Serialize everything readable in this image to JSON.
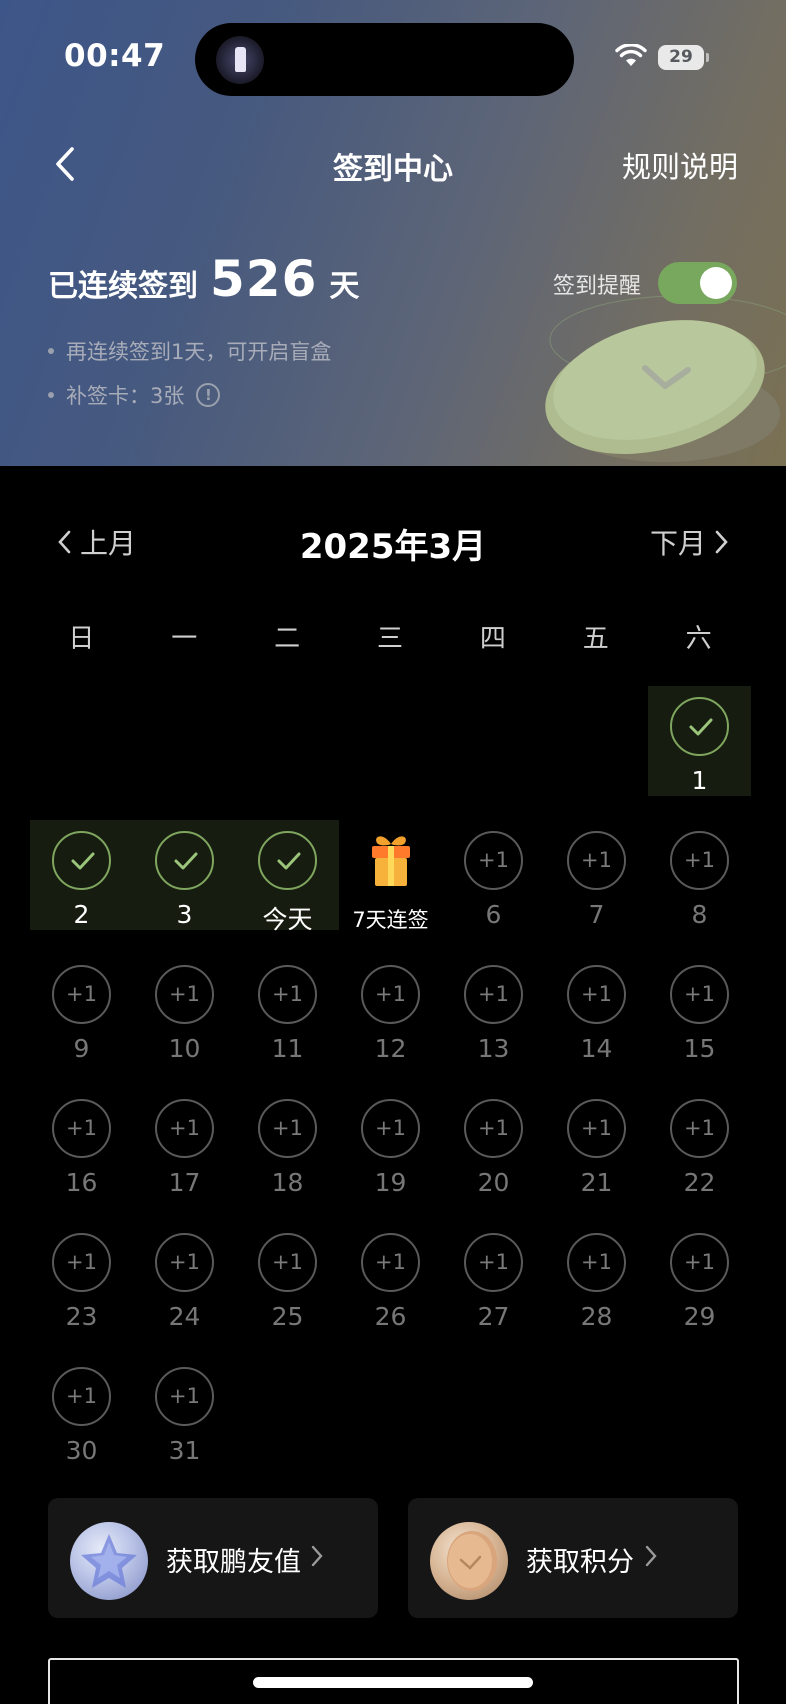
{
  "status_bar": {
    "time": "00:47",
    "battery": "29"
  },
  "nav": {
    "title": "签到中心",
    "rules": "规则说明"
  },
  "streak": {
    "prefix": "已连续签到",
    "days": "526",
    "suffix": "天"
  },
  "tips": [
    "再连续签到1天，可开启盲盒",
    "补签卡：3张"
  ],
  "reminder": {
    "label": "签到提醒",
    "enabled": true
  },
  "calendar": {
    "title": "2025年3月",
    "prev": "上月",
    "next": "下月",
    "weekdays": [
      "日",
      "一",
      "二",
      "三",
      "四",
      "五",
      "六"
    ],
    "leading_blanks": 6,
    "reward_text": "+1",
    "days": [
      {
        "label": "1",
        "status": "checked"
      },
      {
        "label": "2",
        "status": "checked"
      },
      {
        "label": "3",
        "status": "checked"
      },
      {
        "label": "今天",
        "status": "checked"
      },
      {
        "label": "7天连签",
        "status": "gift"
      },
      {
        "label": "6",
        "status": "pending"
      },
      {
        "label": "7",
        "status": "pending"
      },
      {
        "label": "8",
        "status": "pending"
      },
      {
        "label": "9",
        "status": "pending"
      },
      {
        "label": "10",
        "status": "pending"
      },
      {
        "label": "11",
        "status": "pending"
      },
      {
        "label": "12",
        "status": "pending"
      },
      {
        "label": "13",
        "status": "pending"
      },
      {
        "label": "14",
        "status": "pending"
      },
      {
        "label": "15",
        "status": "pending"
      },
      {
        "label": "16",
        "status": "pending"
      },
      {
        "label": "17",
        "status": "pending"
      },
      {
        "label": "18",
        "status": "pending"
      },
      {
        "label": "19",
        "status": "pending"
      },
      {
        "label": "20",
        "status": "pending"
      },
      {
        "label": "21",
        "status": "pending"
      },
      {
        "label": "22",
        "status": "pending"
      },
      {
        "label": "23",
        "status": "pending"
      },
      {
        "label": "24",
        "status": "pending"
      },
      {
        "label": "25",
        "status": "pending"
      },
      {
        "label": "26",
        "status": "pending"
      },
      {
        "label": "27",
        "status": "pending"
      },
      {
        "label": "28",
        "status": "pending"
      },
      {
        "label": "29",
        "status": "pending"
      },
      {
        "label": "30",
        "status": "pending"
      },
      {
        "label": "31",
        "status": "pending"
      }
    ]
  },
  "cards": [
    {
      "label": "获取鹏友值",
      "icon": "crystal-star-icon"
    },
    {
      "label": "获取积分",
      "icon": "points-coin-icon"
    }
  ],
  "colors": {
    "accent_green": "#7fa55e",
    "toggle_on": "#78a85d",
    "checked_bg": "#161d10"
  }
}
